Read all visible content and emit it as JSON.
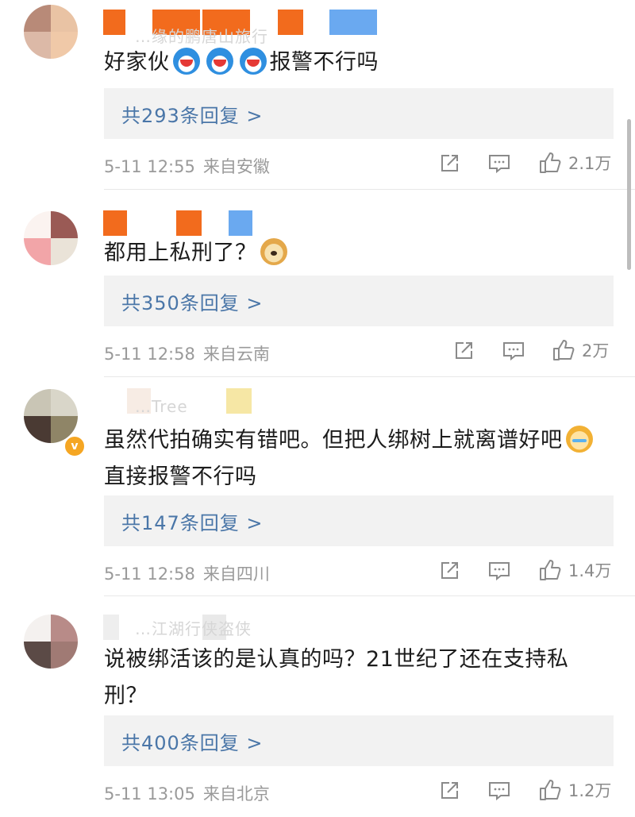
{
  "comments": [
    {
      "user_name": "…缘的鹏唐山旅行",
      "content": "好家伙",
      "content_tail": "报警不行吗",
      "reply_label": "共293条回复 >",
      "time": "5-11 12:55",
      "location": "来自安徽",
      "likes": "2.1万",
      "emojis": [
        "doraemon-emoji",
        "doraemon-emoji",
        "doraemon-emoji"
      ]
    },
    {
      "user_name": "",
      "content": "都用上私刑了？",
      "reply_label": "共350条回复 >",
      "time": "5-11 12:58",
      "location": "来自云南",
      "likes": "2万",
      "emojis": [
        "doge-emoji"
      ]
    },
    {
      "user_name": "…Tree",
      "verified": "v",
      "content_line1": "虽然代拍确实有错吧。但把人绑树上就离谱好吧",
      "content_line2": "直接报警不行吗",
      "reply_label": "共147条回复 >",
      "time": "5-11 12:58",
      "location": "来自四川",
      "likes": "1.4万",
      "emojis": [
        "cat-emoji"
      ]
    },
    {
      "user_name": "…江湖行侠盗侠",
      "content_line1": "说被绑活该的是认真的吗？21世纪了还在支持私",
      "content_line2": "刑？",
      "reply_label": "共400条回复 >",
      "time": "5-11 13:05",
      "location": "来自北京",
      "likes": "1.2万"
    }
  ],
  "icons": {
    "share": "share-icon",
    "comment": "comment-icon",
    "like": "thumbs-up-icon"
  },
  "colors": {
    "reply_link": "#4a76a8",
    "reply_bg": "#f2f2f2",
    "meta": "#9a9a9a",
    "verified_badge": "#f5a623"
  }
}
